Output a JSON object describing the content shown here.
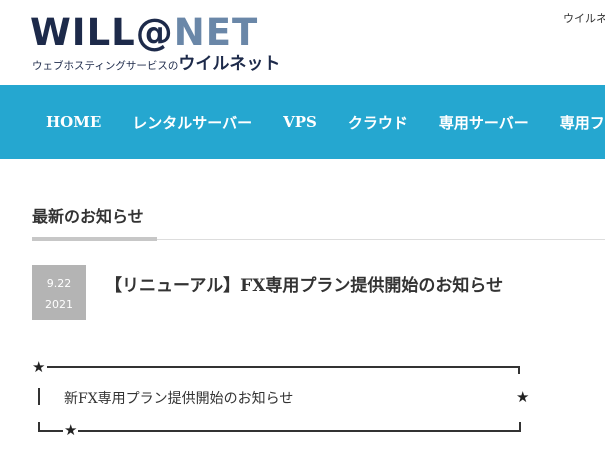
{
  "header": {
    "logo": {
      "part1": "WILL@",
      "part2": "NET",
      "tagline": "ウェブホスティングサービスの",
      "tagline_brand": "ウイルネット"
    },
    "right_text": "ウイルネ"
  },
  "nav": {
    "items": [
      {
        "label": "HOME"
      },
      {
        "label": "レンタルサーバー"
      },
      {
        "label": "VPS"
      },
      {
        "label": "クラウド"
      },
      {
        "label": "専用サーバー"
      },
      {
        "label": "専用フ"
      }
    ]
  },
  "news": {
    "section_heading": "最新のお知らせ",
    "items": [
      {
        "date_md": "9.22",
        "date_year": "2021",
        "title": "【リニューアル】FX専用プラン提供開始のお知らせ"
      }
    ]
  },
  "decoration": {
    "star": "★",
    "inner_text": "新FX専用プラン提供開始のお知らせ"
  },
  "colors": {
    "nav_bg": "#25a7d0",
    "logo_dark": "#1d2a4a",
    "logo_net": "#6a87a8",
    "date_box_bg": "#b4b4b4"
  }
}
